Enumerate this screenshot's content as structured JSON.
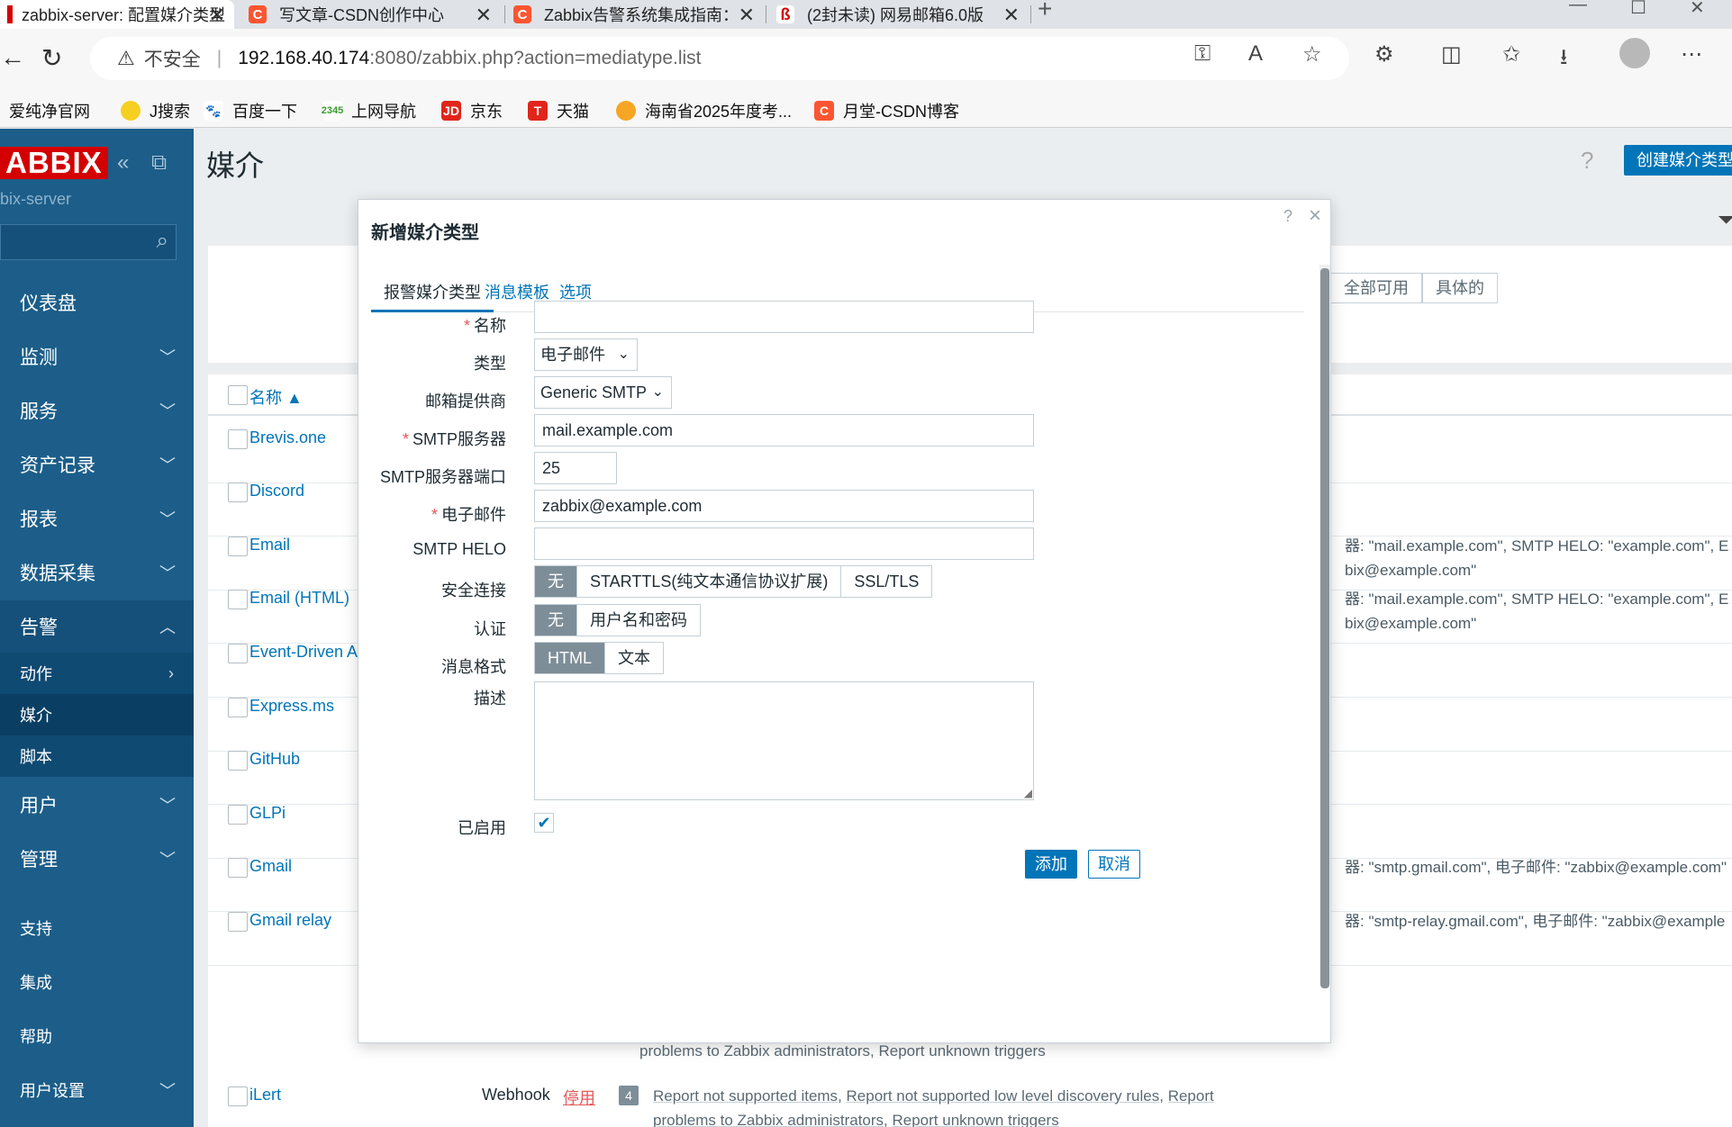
{
  "browser": {
    "tabs": [
      {
        "title": "zabbix-server: 配置媒介类型",
        "active": true
      },
      {
        "title": "写文章-CSDN创作中心"
      },
      {
        "title": "Zabbix告警系统集成指南：从钉钉"
      },
      {
        "title": "(2封未读) 网易邮箱6.0版"
      }
    ],
    "insecure_label": "不安全",
    "url_host": "192.168.40.174",
    "url_rest": ":8080/zabbix.php?action=mediatype.list",
    "bookmarks": [
      "爱纯净官网",
      "J搜索",
      "百度一下",
      "上网导航",
      "京东",
      "天猫",
      "海南省2025年度考...",
      "月堂-CSDN博客"
    ]
  },
  "sidebar": {
    "logo": "ABBIX",
    "server": "bix-server",
    "menu": [
      "仪表盘",
      "监测",
      "服务",
      "资产记录",
      "报表",
      "数据采集",
      "告警"
    ],
    "alert_sub": [
      "动作",
      "媒介",
      "脚本"
    ],
    "menu2": [
      "用户",
      "管理"
    ],
    "bottom": [
      "支持",
      "集成",
      "帮助",
      "用户设置"
    ]
  },
  "main": {
    "title": "媒介",
    "help": "?",
    "create_button": "创建媒介类型",
    "filter_tags": [
      "全部可用",
      "具体的"
    ],
    "col_name": "名称 ▲",
    "rows": [
      {
        "name": "Brevis.one",
        "detail1": "",
        "detail2": ""
      },
      {
        "name": "Discord",
        "detail1": "",
        "detail2": ""
      },
      {
        "name": "Email",
        "detail1": "器: \"mail.example.com\", SMTP HELO: \"example.com\", E",
        "detail2": "bix@example.com\""
      },
      {
        "name": "Email (HTML)",
        "detail1": "器: \"mail.example.com\", SMTP HELO: \"example.com\", E",
        "detail2": "bix@example.com\""
      },
      {
        "name": "Event-Driven A",
        "detail1": "",
        "detail2": ""
      },
      {
        "name": "Express.ms",
        "detail1": "",
        "detail2": ""
      },
      {
        "name": "GitHub",
        "detail1": "",
        "detail2": ""
      },
      {
        "name": "GLPi",
        "detail1": "",
        "detail2": ""
      },
      {
        "name": "Gmail",
        "detail1": "器: \"smtp.gmail.com\", 电子邮件: \"zabbix@example.com\"",
        "detail2": ""
      },
      {
        "name": "Gmail relay",
        "detail1": "器: \"smtp-relay.gmail.com\", 电子邮件: \"zabbix@example",
        "detail2": ""
      }
    ],
    "gmail_relay_links": "problems to Zabbix administrators, Report unknown triggers",
    "ilert": {
      "name": "iLert",
      "type": "Webhook",
      "status": "停用",
      "count": "4",
      "link1": "Report not supported items",
      "link2": "Report not supported low level discovery rules",
      "link3": "Report",
      "link4": "problems to Zabbix administrators",
      "link5": "Report unknown triggers"
    }
  },
  "modal": {
    "title": "新增媒介类型",
    "help": "?",
    "close": "×",
    "tabs": [
      "报警媒介类型",
      "消息模板",
      "选项"
    ],
    "labels": {
      "name": "名称",
      "type": "类型",
      "provider": "邮箱提供商",
      "smtp_server": "SMTP服务器",
      "smtp_port": "SMTP服务器端口",
      "email": "电子邮件",
      "smtp_helo": "SMTP HELO",
      "security": "安全连接",
      "auth": "认证",
      "format": "消息格式",
      "description": "描述",
      "enabled": "已启用"
    },
    "values": {
      "name": "",
      "type": "电子邮件",
      "provider": "Generic SMTP",
      "smtp_server": "mail.example.com",
      "smtp_port": "25",
      "email": "zabbix@example.com",
      "smtp_helo": "",
      "description": ""
    },
    "security_opts": [
      "无",
      "STARTTLS(纯文本通信协议扩展)",
      "SSL/TLS"
    ],
    "auth_opts": [
      "无",
      "用户名和密码"
    ],
    "format_opts": [
      "HTML",
      "文本"
    ],
    "enabled_check": "✔",
    "add_button": "添加",
    "cancel_button": "取消"
  },
  "colors": {
    "zabbix_blue": "#0275b8",
    "sidebar": "#1c5e89",
    "logo_red": "#d40000",
    "required": "#e45959"
  }
}
